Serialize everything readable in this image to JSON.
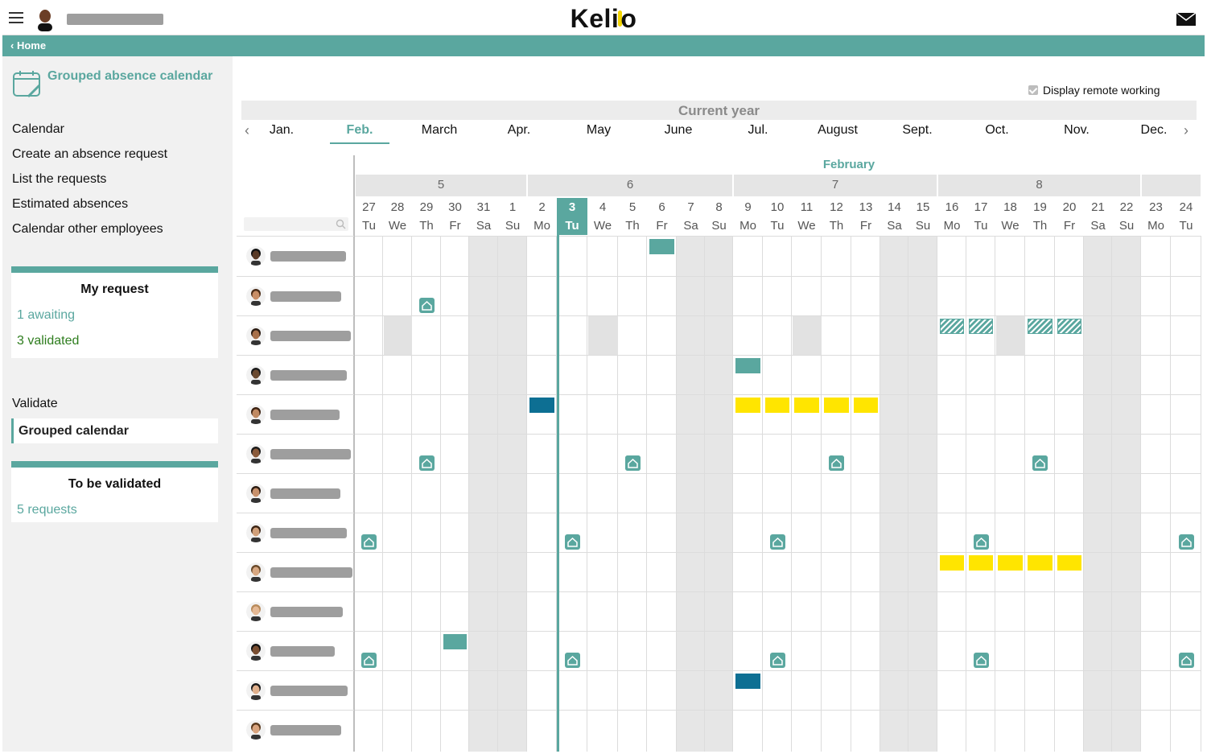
{
  "header": {
    "app_name": "Kelio",
    "logo_left": "Keli",
    "logo_right": "o",
    "menu_icon": "hamburger-icon",
    "mail_icon": "mail-icon"
  },
  "breadcrumb": {
    "home_label": "Home",
    "back_icon": "chevron-left-icon"
  },
  "sidebar": {
    "page_title": "Grouped absence calendar",
    "nav": {
      "calendar": "Calendar",
      "create_request": "Create an absence request",
      "list_requests": "List the requests",
      "estimated": "Estimated absences",
      "other_employees": "Calendar other employees"
    },
    "my_request": {
      "title": "My request",
      "awaiting": "1 awaiting",
      "validated": "3 validated"
    },
    "validate_label": "Validate",
    "grouped_calendar": "Grouped calendar",
    "to_validate": {
      "title": "To be validated",
      "requests": "5 requests"
    }
  },
  "calendar": {
    "remote_working_label": "Display remote working",
    "remote_working_checked": true,
    "year_label": "Current year",
    "months": [
      "Jan.",
      "Feb.",
      "March",
      "Apr.",
      "May",
      "June",
      "Jul.",
      "August",
      "Sept.",
      "Oct.",
      "Nov.",
      "Dec."
    ],
    "active_month": "Feb.",
    "current_month_name": "February",
    "weeks": [
      "5",
      "6",
      "7",
      "8"
    ],
    "days": [
      {
        "n": "27",
        "d": "Tu"
      },
      {
        "n": "28",
        "d": "We"
      },
      {
        "n": "29",
        "d": "Th"
      },
      {
        "n": "30",
        "d": "Fr"
      },
      {
        "n": "31",
        "d": "Sa"
      },
      {
        "n": "1",
        "d": "Su"
      },
      {
        "n": "2",
        "d": "Mo"
      },
      {
        "n": "3",
        "d": "Tu"
      },
      {
        "n": "4",
        "d": "We"
      },
      {
        "n": "5",
        "d": "Th"
      },
      {
        "n": "6",
        "d": "Fr"
      },
      {
        "n": "7",
        "d": "Sa"
      },
      {
        "n": "8",
        "d": "Su"
      },
      {
        "n": "9",
        "d": "Mo"
      },
      {
        "n": "10",
        "d": "Tu"
      },
      {
        "n": "11",
        "d": "We"
      },
      {
        "n": "12",
        "d": "Th"
      },
      {
        "n": "13",
        "d": "Fr"
      },
      {
        "n": "14",
        "d": "Sa"
      },
      {
        "n": "15",
        "d": "Su"
      },
      {
        "n": "16",
        "d": "Mo"
      },
      {
        "n": "17",
        "d": "Tu"
      },
      {
        "n": "18",
        "d": "We"
      },
      {
        "n": "19",
        "d": "Th"
      },
      {
        "n": "20",
        "d": "Fr"
      },
      {
        "n": "21",
        "d": "Sa"
      },
      {
        "n": "22",
        "d": "Su"
      },
      {
        "n": "23",
        "d": "Mo"
      },
      {
        "n": "24",
        "d": "Tu"
      }
    ],
    "today": "3",
    "employee_count": 13,
    "colors": {
      "accent": "#5aa79f",
      "absence_blue": "#0d6f93",
      "absence_yellow": "#ffe500",
      "weekend": "#e6e6e6"
    }
  }
}
